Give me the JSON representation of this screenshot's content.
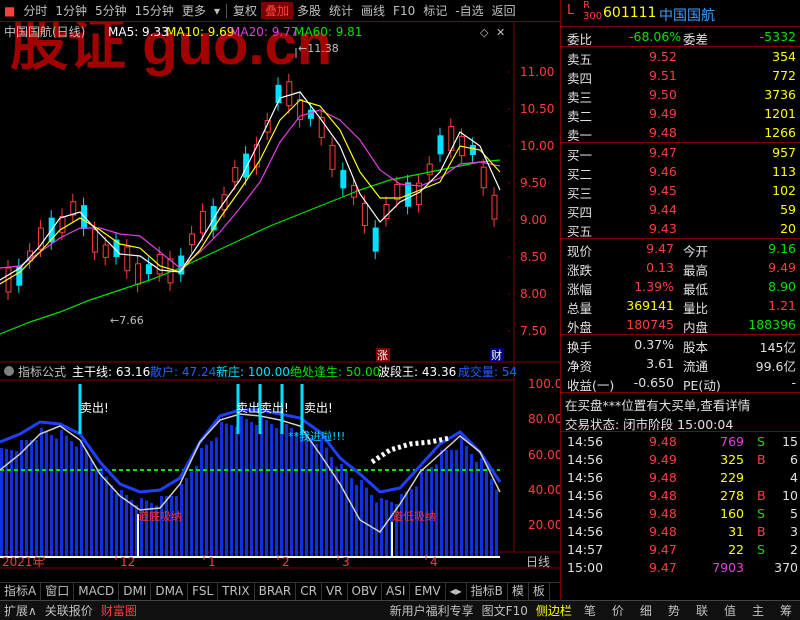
{
  "toolbar": {
    "items": [
      "分时",
      "1分钟",
      "5分钟",
      "15分钟",
      "更多",
      "复权",
      "叠加",
      "多股",
      "统计",
      "画线",
      "F10",
      "标记",
      "-自选",
      "返回"
    ]
  },
  "chart": {
    "title": "中国国航(日线)",
    "ma5": "MA5: 9.33",
    "ma10": "MA10: 9.69",
    "ma20": "MA20: 9.77",
    "ma60": "MA60: 9.81",
    "high_mark": "11.38",
    "low_mark": "7.66",
    "price_ticks": [
      "11.00",
      "10.50",
      "10.00",
      "9.50",
      "9.00",
      "8.50",
      "8.00",
      "7.50"
    ],
    "zhang_label": "涨",
    "cai_label": "财",
    "watermark": "股证 guo.cn"
  },
  "indicator": {
    "name": "指标公式",
    "zhugan": "主干线: 63.16",
    "sanhu": "散户: 47.24",
    "xinzhuang": "新庄: 100.00",
    "juechu": "绝处逢生: 50.00",
    "boduan": "波段王: 43.36",
    "chengjiao": "成交量: 54",
    "ticks": [
      "100.00",
      "80.00",
      "60.00",
      "40.00",
      "20.00"
    ],
    "labels": {
      "sell1": "卖出!",
      "sell2": "卖出卖出!",
      "sell3": "卖出!",
      "wait": "**我进啦!!!",
      "bottom1": "道底吸纳",
      "bottom2": "道低吸纳"
    }
  },
  "timeaxis": {
    "labels": [
      "2021年",
      "12",
      "1",
      "2",
      "3",
      "4"
    ],
    "right": "日线"
  },
  "tabs": [
    "指标A",
    "窗口",
    "MACD",
    "DMI",
    "DMA",
    "FSL",
    "TRIX",
    "BRAR",
    "CR",
    "VR",
    "OBV",
    "ASI",
    "EMV",
    "指标B",
    "模",
    "板"
  ],
  "stock": {
    "code": "601111",
    "name": "中国国航",
    "weibi_label": "委比",
    "weibi": "-68.06%",
    "weicha_label": "委差",
    "weicha": "-5332"
  },
  "asks": [
    {
      "label": "卖五",
      "price": "9.52",
      "vol": "354"
    },
    {
      "label": "卖四",
      "price": "9.51",
      "vol": "772"
    },
    {
      "label": "卖三",
      "price": "9.50",
      "vol": "3736"
    },
    {
      "label": "卖二",
      "price": "9.49",
      "vol": "1201"
    },
    {
      "label": "卖一",
      "price": "9.48",
      "vol": "1266"
    }
  ],
  "bids": [
    {
      "label": "买一",
      "price": "9.47",
      "vol": "957"
    },
    {
      "label": "买二",
      "price": "9.46",
      "vol": "113"
    },
    {
      "label": "买三",
      "price": "9.45",
      "vol": "102"
    },
    {
      "label": "买四",
      "price": "9.44",
      "vol": "59"
    },
    {
      "label": "买五",
      "price": "9.43",
      "vol": "20"
    }
  ],
  "quote": [
    {
      "l1": "现价",
      "v1": "9.47",
      "l2": "今开",
      "v2": "9.16"
    },
    {
      "l1": "涨跌",
      "v1": "0.13",
      "l2": "最高",
      "v2": "9.49"
    },
    {
      "l1": "涨幅",
      "v1": "1.39%",
      "l2": "最低",
      "v2": "8.90"
    },
    {
      "l1": "总量",
      "v1": "369141",
      "l2": "量比",
      "v2": "1.21"
    },
    {
      "l1": "外盘",
      "v1": "180745",
      "l2": "内盘",
      "v2": "188396"
    }
  ],
  "quote2": [
    {
      "l1": "换手",
      "v1": "0.37%",
      "l2": "股本",
      "v2": "145亿"
    },
    {
      "l1": "净资",
      "v1": "3.61",
      "l2": "流通",
      "v2": "99.6亿"
    },
    {
      "l1": "收益(一)",
      "v1": "-0.650",
      "l2": "PE(动)",
      "v2": "-"
    }
  ],
  "notice": "在买盘***位置有大买单,查看详情",
  "status": "交易状态: 闭市阶段 15:00:04",
  "trades": [
    {
      "time": "14:56",
      "price": "9.48",
      "vol": "769",
      "side": "S",
      "n": "15"
    },
    {
      "time": "14:56",
      "price": "9.49",
      "vol": "325",
      "side": "B",
      "n": "6"
    },
    {
      "time": "14:56",
      "price": "9.48",
      "vol": "229",
      "side": "",
      "n": "4"
    },
    {
      "time": "14:56",
      "price": "9.48",
      "vol": "278",
      "side": "B",
      "n": "10"
    },
    {
      "time": "14:56",
      "price": "9.48",
      "vol": "160",
      "side": "S",
      "n": "5"
    },
    {
      "time": "14:56",
      "price": "9.48",
      "vol": "31",
      "side": "B",
      "n": "3"
    },
    {
      "time": "14:57",
      "price": "9.47",
      "vol": "22",
      "side": "S",
      "n": "2"
    },
    {
      "time": "15:00",
      "price": "9.47",
      "vol": "7903",
      "side": "",
      "n": "370"
    }
  ],
  "bottom": {
    "left": [
      "扩展∧",
      "关联报价",
      "财富圈"
    ],
    "middle": [
      "新用户福利专享",
      "图文F10",
      "侧边栏"
    ],
    "right": [
      "笔",
      "价",
      "细",
      "势",
      "联",
      "值",
      "主",
      "筹"
    ]
  }
}
